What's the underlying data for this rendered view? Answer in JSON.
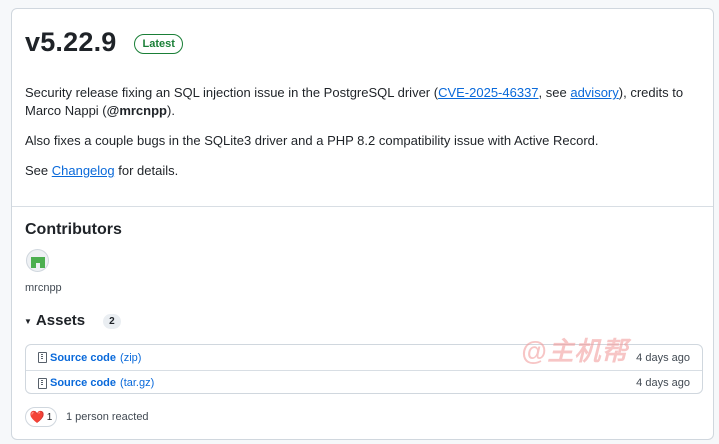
{
  "release": {
    "version": "v5.22.9",
    "latest_label": "Latest",
    "p1_text_a": "Security release fixing an SQL injection issue in the PostgreSQL driver (",
    "p1_link_cve": "CVE-2025-46337",
    "p1_text_b": ", see ",
    "p1_link_advisory": "advisory",
    "p1_text_c": "), credits to Marco Nappi (",
    "p1_mention": "@mrcnpp",
    "p1_text_d": ").",
    "p2": "Also fixes a couple bugs in the SQLite3 driver and a PHP 8.2 compatibility issue with Active Record.",
    "p3_a": "See ",
    "p3_link": "Changelog",
    "p3_b": " for details."
  },
  "contributors": {
    "title": "Contributors",
    "name": "mrcnpp"
  },
  "assets": {
    "title": "Assets",
    "count": "2",
    "items": [
      {
        "name": "Source code",
        "type": "(zip)",
        "date": "4 days ago"
      },
      {
        "name": "Source code",
        "type": "(tar.gz)",
        "date": "4 days ago"
      }
    ]
  },
  "reactions": {
    "emoji": "❤️",
    "count": "1",
    "text": "1 person reacted"
  },
  "watermark": "@主机帮",
  "colors": {
    "link": "#0969da",
    "latest_green": "#1a7f37",
    "heart": "#cf222e"
  }
}
